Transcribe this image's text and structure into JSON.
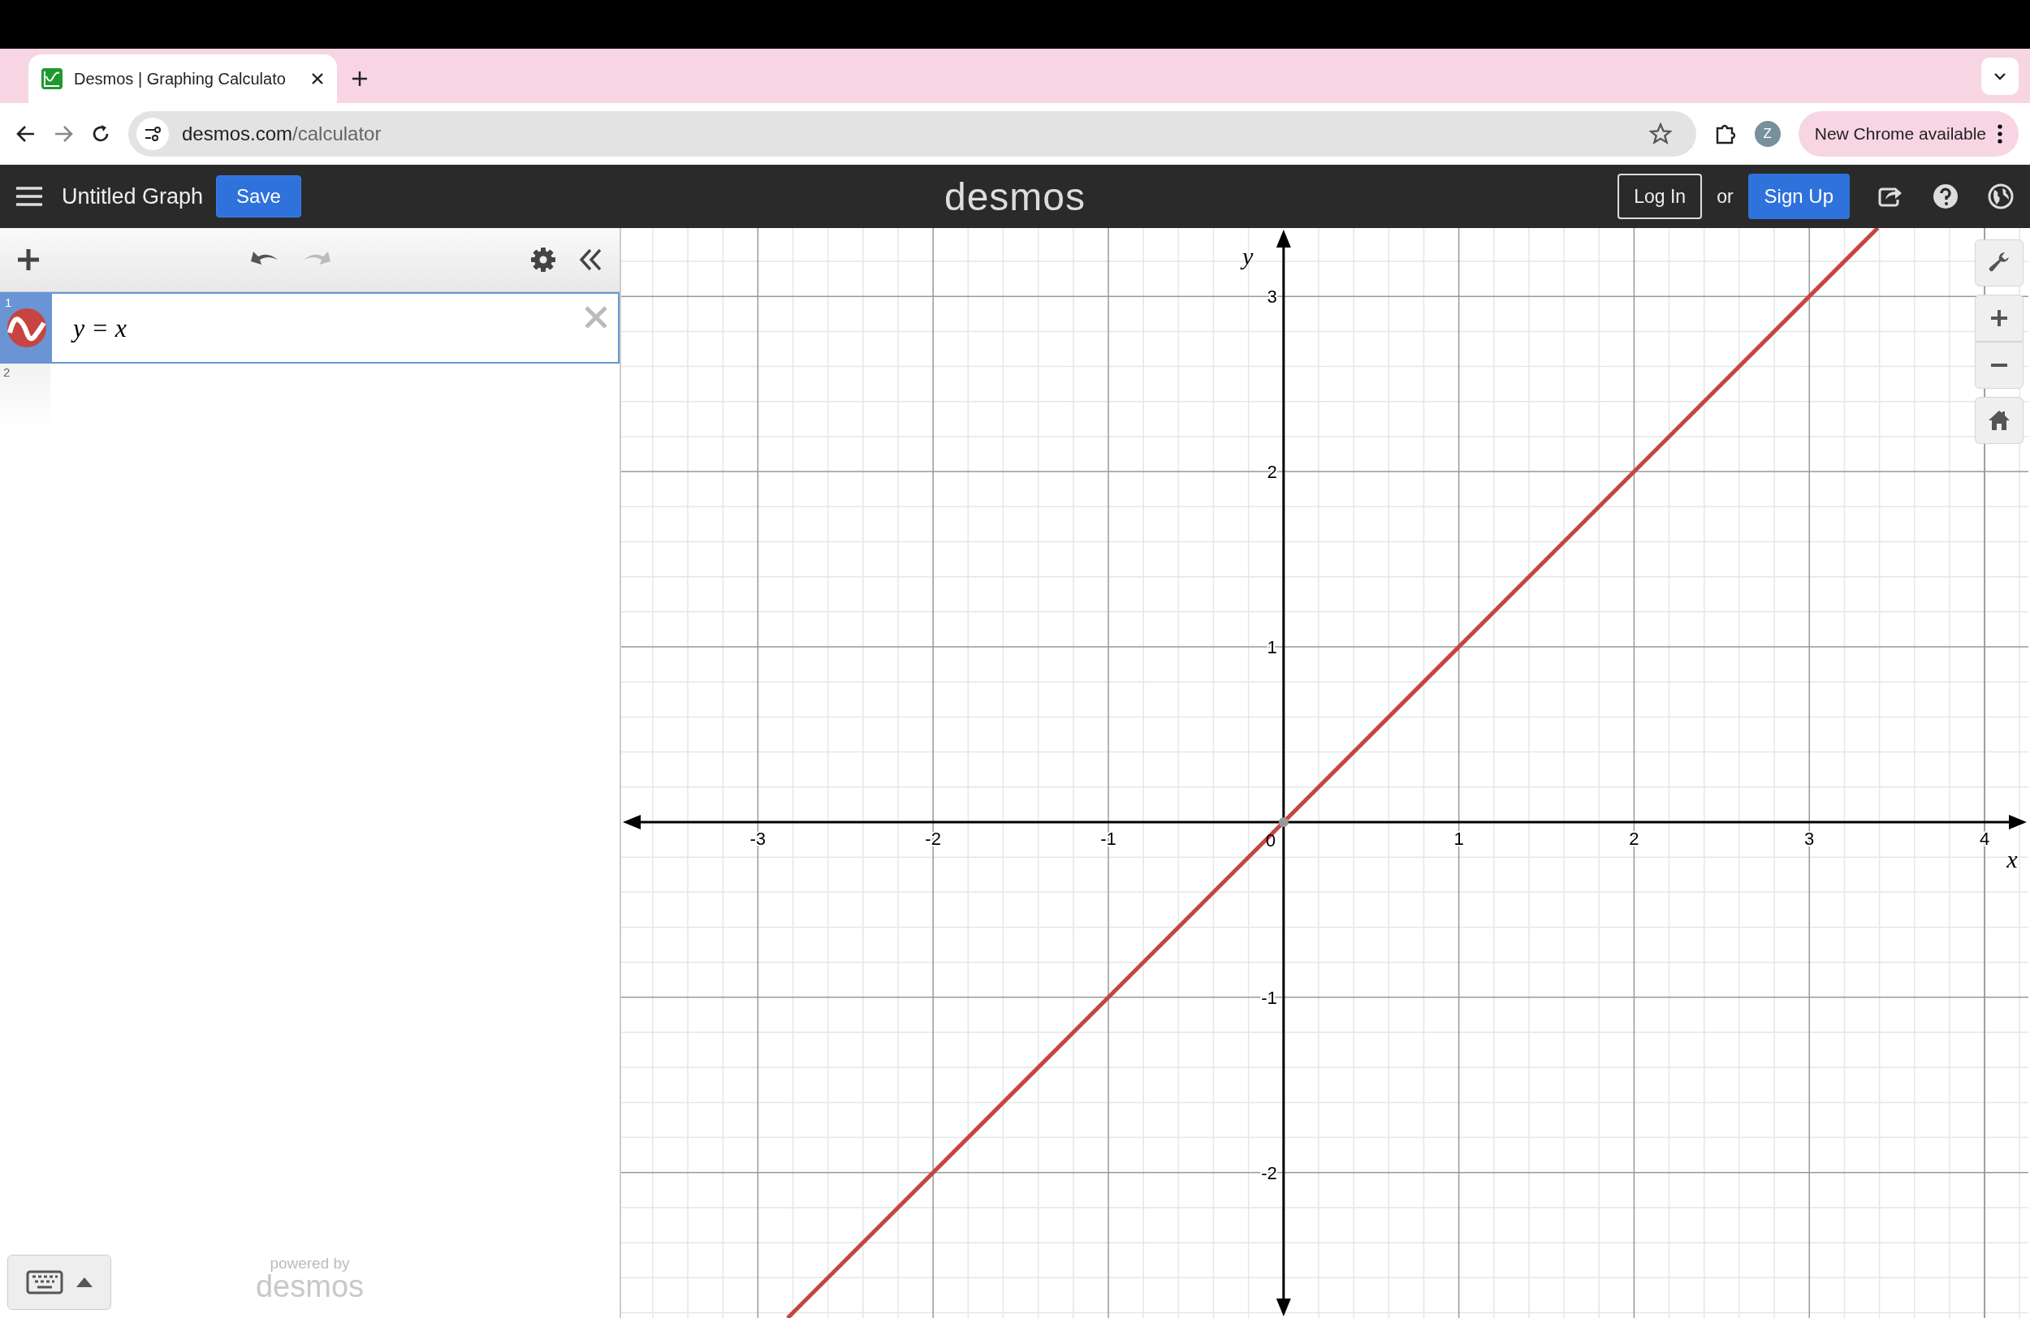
{
  "browser": {
    "tab": {
      "title": "Desmos | Graphing Calculato",
      "selected": true
    },
    "url_host": "desmos.com",
    "url_path": "/calculator",
    "profile": "Z",
    "update_pill": "New Chrome available"
  },
  "header": {
    "title": "Untitled Graph",
    "save": "Save",
    "logo": "desmos",
    "login": "Log In",
    "or": "or",
    "signup": "Sign Up"
  },
  "expressions": [
    {
      "number": "1",
      "text": "y = x",
      "color": "#c74440",
      "selected": true
    },
    {
      "number": "2",
      "selected": false
    }
  ],
  "footer": {
    "powered": "powered by",
    "brand": "desmos"
  },
  "graph": {
    "origin_label": "0",
    "chart_data": {
      "type": "line",
      "xlabel": "x",
      "ylabel": "y",
      "x": [
        -2.83,
        3.39
      ],
      "series": [
        {
          "color": "#c74440",
          "values": [
            -2.83,
            3.39
          ]
        }
      ],
      "xlim": [
        -3.78,
        4.25
      ],
      "ylim": [
        -2.83,
        3.39
      ],
      "xticks": [
        -3,
        -2,
        -1,
        1,
        2,
        3,
        4
      ],
      "grid": true,
      "yticks": [
        -2,
        -1,
        1,
        2,
        3
      ]
    }
  }
}
